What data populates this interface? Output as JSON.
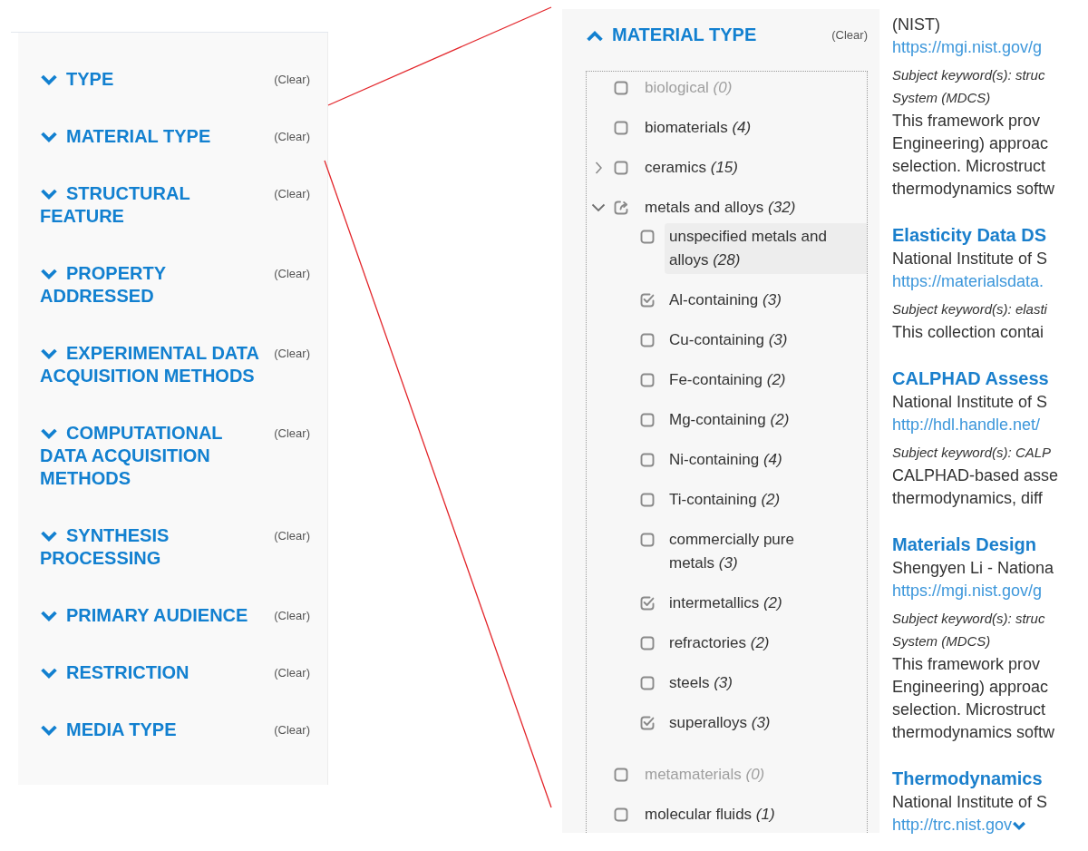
{
  "facet_panel": {
    "sections": [
      {
        "title": "TYPE",
        "expanded": false,
        "clear": "(Clear)"
      },
      {
        "title": "MATERIAL TYPE",
        "expanded": false,
        "clear": "(Clear)"
      },
      {
        "title": "STRUCTURAL FEATURE",
        "expanded": false,
        "clear": "(Clear)"
      },
      {
        "title": "PROPERTY ADDRESSED",
        "expanded": false,
        "clear": "(Clear)"
      },
      {
        "title": "EXPERIMENTAL DATA ACQUISITION METHODS",
        "expanded": false,
        "clear": "(Clear)"
      },
      {
        "title": "COMPUTATIONAL DATA ACQUISITION METHODS",
        "expanded": false,
        "clear": "(Clear)"
      },
      {
        "title": "SYNTHESIS PROCESSING",
        "expanded": false,
        "clear": "(Clear)"
      },
      {
        "title": "PRIMARY AUDIENCE",
        "expanded": false,
        "clear": "(Clear)"
      },
      {
        "title": "RESTRICTION",
        "expanded": false,
        "clear": "(Clear)"
      },
      {
        "title": "MEDIA TYPE",
        "expanded": false,
        "clear": "(Clear)"
      }
    ]
  },
  "zoomed_facet": {
    "title": "MATERIAL TYPE",
    "expanded": true,
    "clear": "(Clear)",
    "options": [
      {
        "label": "biological *(0)*",
        "kind": "leaf",
        "checked": false,
        "partial": false,
        "disabled": true,
        "highlighted": false
      },
      {
        "label": "biomaterials *(4)*",
        "kind": "leaf",
        "checked": false,
        "partial": false,
        "disabled": false,
        "highlighted": false
      },
      {
        "label": "ceramics *(15)*",
        "kind": "group",
        "expanded": false,
        "checked": false,
        "partial": false,
        "disabled": false,
        "highlighted": false
      },
      {
        "label": "metals and alloys *(32)*",
        "kind": "group",
        "expanded": true,
        "checked": false,
        "partial": true,
        "disabled": false,
        "highlighted": false,
        "children": [
          {
            "label": "unspecified metals and alloys *(28)*",
            "checked": false,
            "disabled": false,
            "highlighted": true
          },
          {
            "label": "Al-containing *(3)*",
            "checked": true,
            "disabled": false,
            "highlighted": false
          },
          {
            "label": "Cu-containing *(3)*",
            "checked": false,
            "disabled": false,
            "highlighted": false
          },
          {
            "label": "Fe-containing *(2)*",
            "checked": false,
            "disabled": false,
            "highlighted": false
          },
          {
            "label": "Mg-containing *(2)*",
            "checked": false,
            "disabled": false,
            "highlighted": false
          },
          {
            "label": "Ni-containing *(4)*",
            "checked": false,
            "disabled": false,
            "highlighted": false
          },
          {
            "label": "Ti-containing *(2)*",
            "checked": false,
            "disabled": false,
            "highlighted": false
          },
          {
            "label": "commercially pure metals *(3)*",
            "checked": false,
            "disabled": false,
            "highlighted": false
          },
          {
            "label": "intermetallics *(2)*",
            "checked": true,
            "disabled": false,
            "highlighted": false
          },
          {
            "label": "refractories *(2)*",
            "checked": false,
            "disabled": false,
            "highlighted": false
          },
          {
            "label": "steels *(3)*",
            "checked": false,
            "disabled": false,
            "highlighted": false
          },
          {
            "label": "superalloys *(3)*",
            "checked": true,
            "disabled": false,
            "highlighted": false
          }
        ]
      },
      {
        "label": "metamaterials *(0)*",
        "kind": "leaf",
        "checked": false,
        "partial": false,
        "disabled": true,
        "highlighted": false
      },
      {
        "label": "molecular fluids *(1)*",
        "kind": "leaf",
        "checked": false,
        "partial": false,
        "disabled": false,
        "highlighted": false
      }
    ]
  },
  "results": [
    {
      "publisher": "(NIST)",
      "url": "https://mgi.nist.gov/g",
      "keywords": [
        "Subject keyword(s): struc",
        "System (MDCS)"
      ],
      "description": [
        "This framework prov",
        "Engineering) approac",
        "selection. Microstruct",
        "thermodynamics softw"
      ],
      "expand_arrow": false
    },
    {
      "title": "Elasticity Data DS",
      "publisher": "National Institute of S",
      "url": "https://materialsdata.",
      "keywords": [
        "Subject keyword(s): elasti"
      ],
      "description": [
        "This collection contai"
      ],
      "expand_arrow": false
    },
    {
      "title": "CALPHAD Assess",
      "publisher": "National Institute of S",
      "url": "http://hdl.handle.net/",
      "keywords": [
        "Subject keyword(s): CALP"
      ],
      "description": [
        "CALPHAD-based asse",
        "thermodynamics, diff"
      ],
      "expand_arrow": false
    },
    {
      "title": "Materials Design",
      "publisher": "Shengyen Li - Nationa",
      "url": "https://mgi.nist.gov/g",
      "keywords": [
        "Subject keyword(s): struc",
        "System (MDCS)"
      ],
      "description": [
        "This framework prov",
        "Engineering) approac",
        "selection. Microstruct",
        "thermodynamics softw"
      ],
      "expand_arrow": false
    },
    {
      "title": "Thermodynamics",
      "publisher": "National Institute of S",
      "url": "http://trc.nist.gov",
      "expand_arrow": true
    }
  ]
}
